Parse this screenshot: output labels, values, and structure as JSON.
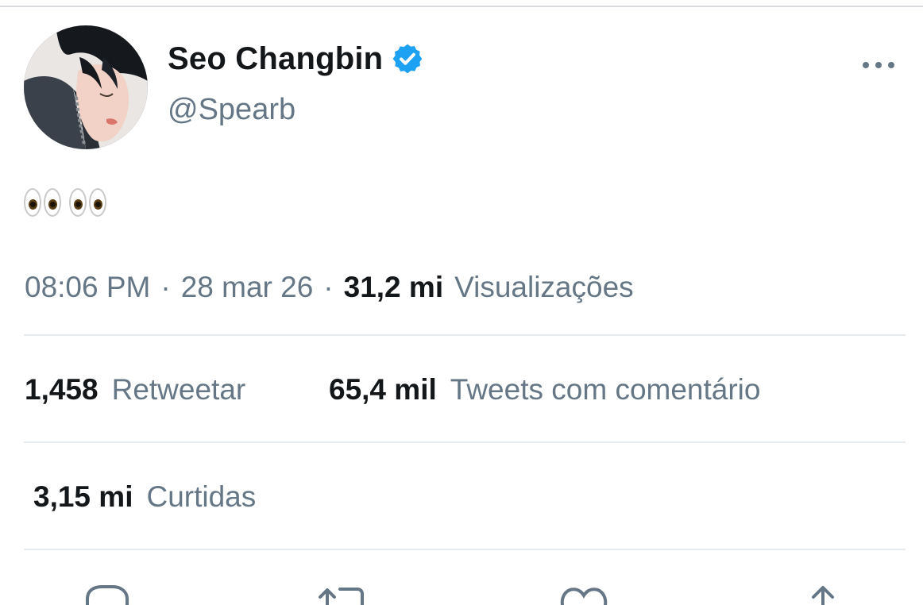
{
  "colors": {
    "text_primary": "#14171a",
    "text_secondary": "#657786",
    "verified_blue": "#1da1f2",
    "divider": "#e6ecf0"
  },
  "author": {
    "display_name": "Seo Changbin",
    "handle": "@Spearb",
    "verified": true,
    "avatar_icon": "profile-photo"
  },
  "tweet": {
    "text": "👀👀"
  },
  "meta": {
    "time": "08:06 PM",
    "date": "28 mar 26",
    "separator": "·",
    "views_count": "31,2 mi",
    "views_label": "Visualizações"
  },
  "stats": {
    "retweets_count": "1,458",
    "retweets_label": "Retweetar",
    "quotes_count": "65,4 mil",
    "quotes_label": "Tweets com comentário",
    "likes_count": "3,15 mi",
    "likes_label": "Curtidas"
  },
  "actions": [
    {
      "icon": "reply-icon"
    },
    {
      "icon": "retweet-icon"
    },
    {
      "icon": "heart-icon"
    },
    {
      "icon": "share-icon"
    }
  ]
}
